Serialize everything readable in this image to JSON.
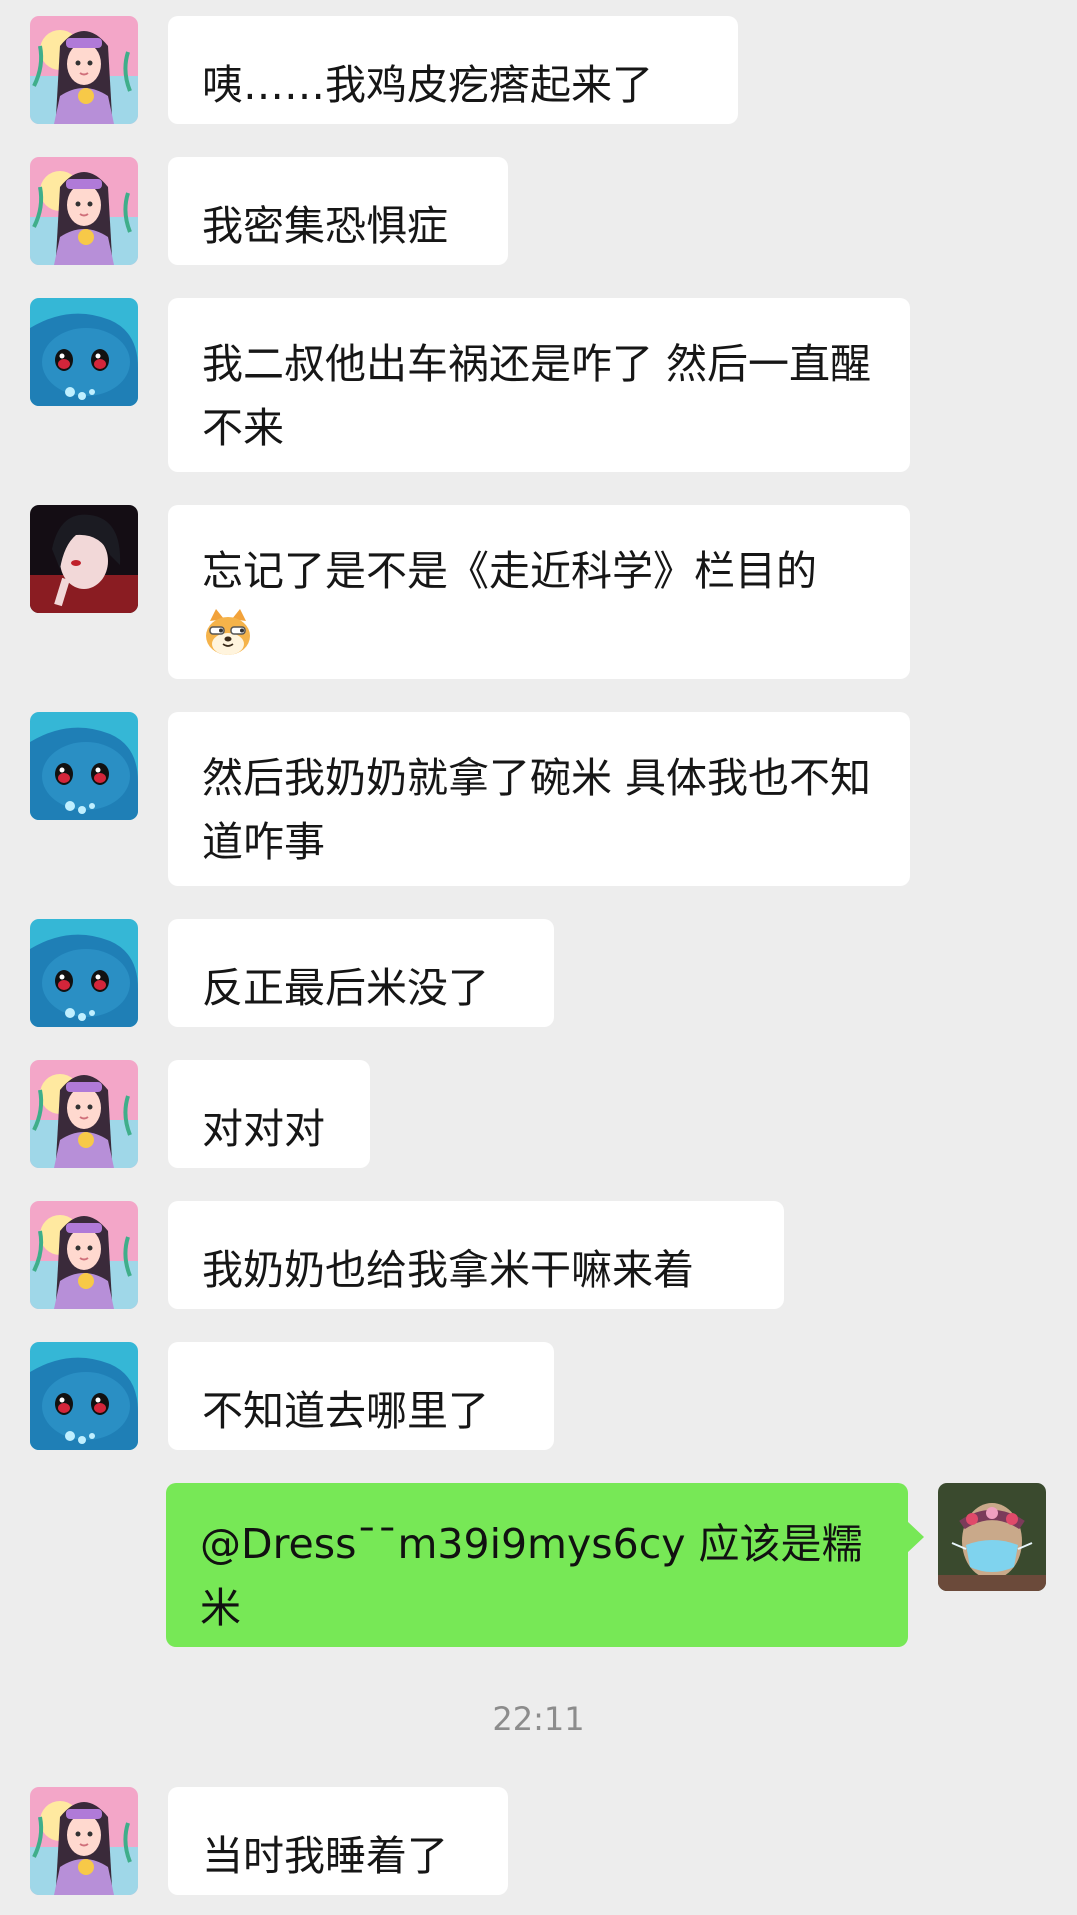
{
  "colors": {
    "background": "#ededed",
    "incoming_bubble": "#ffffff",
    "outgoing_bubble": "#77e856",
    "timestamp_text": "#8c8c8c"
  },
  "messages": [
    {
      "sender": "girl",
      "avatar_icon": "girl-avatar-icon",
      "text": "咦……我鸡皮疙瘩起来了"
    },
    {
      "sender": "girl",
      "avatar_icon": "girl-avatar-icon",
      "text": "我密集恐惧症"
    },
    {
      "sender": "whale",
      "avatar_icon": "whale-avatar-icon",
      "text": "我二叔他出车祸还是咋了  然后一直醒不来"
    },
    {
      "sender": "boy",
      "avatar_icon": "boy-avatar-icon",
      "text": "忘记了是不是《走近科学》栏目的",
      "emoji_icon": "doge-emoji-icon"
    },
    {
      "sender": "whale",
      "avatar_icon": "whale-avatar-icon",
      "text": "然后我奶奶就拿了碗米 具体我也不知道咋事"
    },
    {
      "sender": "whale",
      "avatar_icon": "whale-avatar-icon",
      "text": "反正最后米没了"
    },
    {
      "sender": "girl",
      "avatar_icon": "girl-avatar-icon",
      "text": "对对对"
    },
    {
      "sender": "girl",
      "avatar_icon": "girl-avatar-icon",
      "text": "我奶奶也给我拿米干嘛来着"
    },
    {
      "sender": "whale",
      "avatar_icon": "whale-avatar-icon",
      "text": "不知道去哪里了"
    },
    {
      "sender": "me",
      "avatar_icon": "masked-portrait-avatar-icon",
      "text": "@Dress¯¯m39i9mys6cy 应该是糯米"
    },
    {
      "sender": "girl",
      "avatar_icon": "girl-avatar-icon",
      "text": "当时我睡着了"
    }
  ],
  "timestamp": "22:11"
}
